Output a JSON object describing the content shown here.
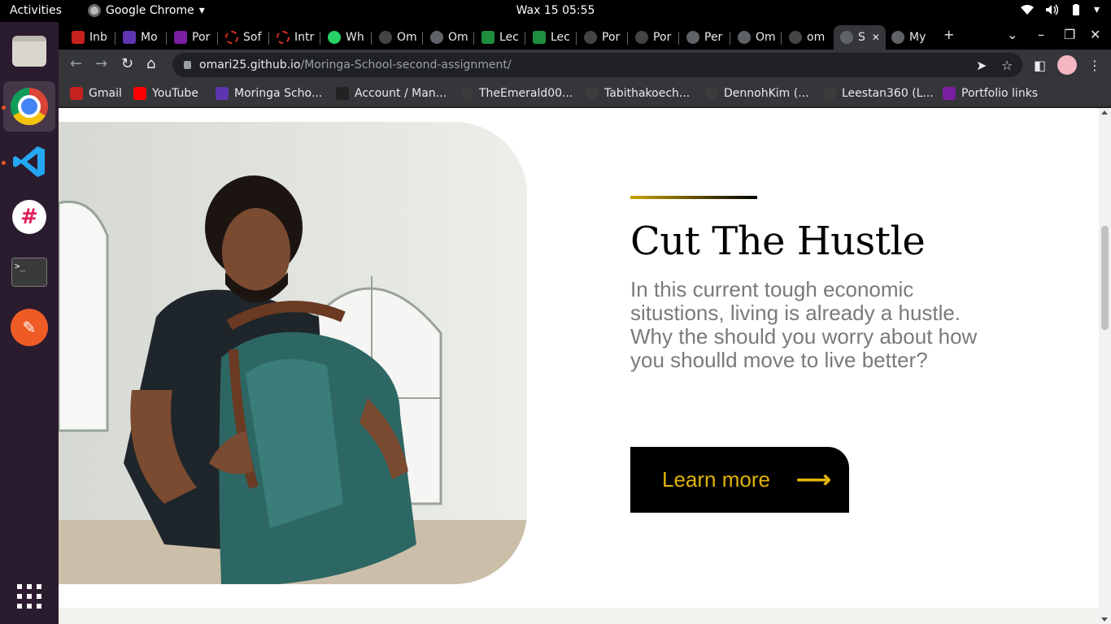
{
  "system": {
    "activities": "Activities",
    "app_name": "Google Chrome",
    "clock": "Wax 15  05:55"
  },
  "dock": {
    "items": [
      "Files",
      "Google Chrome",
      "Visual Studio Code",
      "Slack",
      "Terminal",
      "Postman",
      "Show Applications"
    ]
  },
  "browser": {
    "tabs": [
      {
        "label": "Inb",
        "icon": "gmail-icon"
      },
      {
        "label": "Mo",
        "icon": "calendar-icon"
      },
      {
        "label": "Por",
        "icon": "forms-icon"
      },
      {
        "label": "Sof",
        "icon": "ring-icon"
      },
      {
        "label": "Intr",
        "icon": "ring-icon"
      },
      {
        "label": "Wh",
        "icon": "whatsapp-icon"
      },
      {
        "label": "Om",
        "icon": "github-icon"
      },
      {
        "label": "Om",
        "icon": "globe-icon"
      },
      {
        "label": "Lec",
        "icon": "drive-icon"
      },
      {
        "label": "Lec",
        "icon": "drive-icon"
      },
      {
        "label": "Por",
        "icon": "github-icon"
      },
      {
        "label": "Por",
        "icon": "github-icon"
      },
      {
        "label": "Per",
        "icon": "globe-icon"
      },
      {
        "label": "Om",
        "icon": "globe-icon"
      },
      {
        "label": "om",
        "icon": "github-icon"
      },
      {
        "label": "S",
        "icon": "globe-icon"
      },
      {
        "label": "My",
        "icon": "globe-icon"
      }
    ],
    "url_host": "omari25.github.io",
    "url_path": "/Moringa-School-second-assignment/",
    "bookmarks": [
      {
        "label": "Gmail",
        "icon": "gmail-icon"
      },
      {
        "label": "YouTube",
        "icon": "youtube-icon"
      },
      {
        "label": "Moringa Scho...",
        "icon": "calendar-icon"
      },
      {
        "label": "Account / Man...",
        "icon": "slash-icon"
      },
      {
        "label": "TheEmerald00...",
        "icon": "github-icon"
      },
      {
        "label": "Tabithakoech...",
        "icon": "github-icon"
      },
      {
        "label": "DennohKim (...",
        "icon": "github-icon"
      },
      {
        "label": "Leestan360 (L...",
        "icon": "github-icon"
      },
      {
        "label": "Portfolio links",
        "icon": "forms-icon"
      }
    ]
  },
  "page": {
    "headline": "Cut The Hustle",
    "blurb": "In this current tough economic situstions, living is already a hustle. Why the should you worry about how you shoulld move to live better?",
    "cta_label": "Learn more",
    "cta_arrow": "⟶",
    "accent_color": "#e2b40a"
  }
}
